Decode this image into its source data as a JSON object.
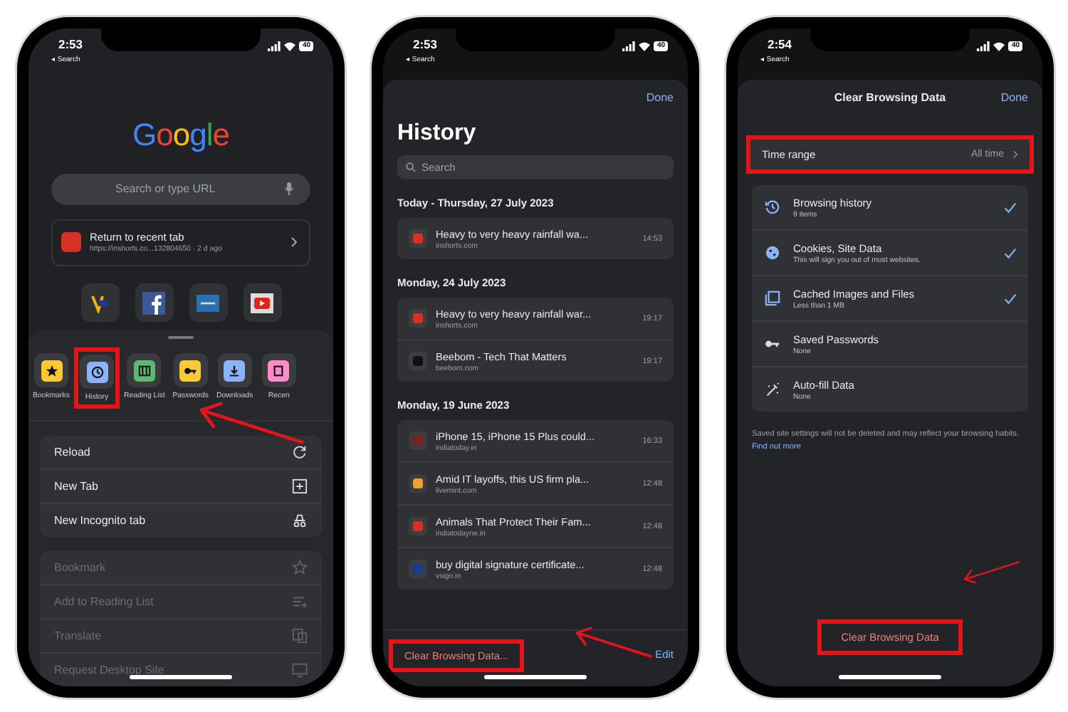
{
  "new_tab_screen": {
    "status_bar": {
      "time": "2:53",
      "back": "◂ Search",
      "battery": "40"
    },
    "logo": "Google",
    "search": {
      "placeholder": "Search or type URL"
    },
    "recent_tab": {
      "title": "Return to recent tab",
      "subtitle": "https://inshorts.co...132804650 · 2 d ago"
    },
    "quick_actions": [
      {
        "kind": "bookmarks",
        "label": "Bookmarks",
        "color": "#fcc934",
        "highlighted": false
      },
      {
        "kind": "history",
        "label": "History",
        "color": "#8ab4f8",
        "highlighted": true
      },
      {
        "kind": "reading_list",
        "label": "Reading List",
        "color": "#5bb974",
        "highlighted": false
      },
      {
        "kind": "passwords",
        "label": "Passwords",
        "color": "#fcc934",
        "highlighted": false
      },
      {
        "kind": "downloads",
        "label": "Downloads",
        "color": "#8ab4f8",
        "highlighted": false
      },
      {
        "kind": "recent",
        "label": "Recen",
        "color": "#ff8bcb",
        "highlighted": false
      }
    ],
    "menu": [
      {
        "kind": "reload",
        "label": "Reload",
        "disabled": false
      },
      {
        "kind": "new_tab",
        "label": "New Tab",
        "disabled": false
      },
      {
        "kind": "incognito",
        "label": "New Incognito tab",
        "disabled": false
      }
    ],
    "menu_2": [
      {
        "kind": "bookmark",
        "label": "Bookmark",
        "disabled": true
      },
      {
        "kind": "reading_list_add",
        "label": "Add to Reading List",
        "disabled": true
      },
      {
        "kind": "translate",
        "label": "Translate",
        "disabled": true
      },
      {
        "kind": "desktop",
        "label": "Request Desktop Site",
        "disabled": true
      }
    ]
  },
  "history_screen": {
    "status_bar": {
      "time": "2:53",
      "back": "◂ Search",
      "battery": "40"
    },
    "done": "Done",
    "title": "History",
    "search": {
      "placeholder": "Search"
    },
    "groups": [
      {
        "heading": "Today - Thursday, 27 July 2023",
        "items": [
          {
            "title": "Heavy to very heavy rainfall wa...",
            "domain": "inshorts.com",
            "time": "14:53",
            "color": "#d93025"
          }
        ]
      },
      {
        "heading": "Monday, 24 July 2023",
        "items": [
          {
            "title": "Heavy to very heavy rainfall war...",
            "domain": "inshorts.com",
            "time": "19:17",
            "color": "#d93025"
          },
          {
            "title": "Beebom - Tech That Matters",
            "domain": "beebom.com",
            "time": "19:17",
            "color": "#111111"
          }
        ]
      },
      {
        "heading": "Monday, 19 June 2023",
        "items": [
          {
            "title": "iPhone 15, iPhone 15 Plus could...",
            "domain": "indiatoday.in",
            "time": "16:33",
            "color": "#7a2020"
          },
          {
            "title": "Amid IT layoffs, this US firm pla...",
            "domain": "livemint.com",
            "time": "12:48",
            "color": "#f0a030"
          },
          {
            "title": "Animals That Protect Their Fam...",
            "domain": "indiatodayne.in",
            "time": "12:48",
            "color": "#d93025"
          },
          {
            "title": "buy digital signature certificate...",
            "domain": "vsign.in",
            "time": "12:48",
            "color": "#1a3a8a"
          }
        ]
      }
    ],
    "clear_button": {
      "label": "Clear Browsing Data...",
      "highlighted": true
    },
    "edit": "Edit"
  },
  "clear_data_screen": {
    "status_bar": {
      "time": "2:54",
      "back": "◂ Search",
      "battery": "40"
    },
    "title": "Clear Browsing Data",
    "done": "Done",
    "time_range": {
      "label": "Time range",
      "value": "All time",
      "highlighted": true
    },
    "options": [
      {
        "kind": "history",
        "label": "Browsing history",
        "detail": "9 items",
        "checked": true
      },
      {
        "kind": "cookies",
        "label": "Cookies, Site Data",
        "detail": "This will sign you out of most websites.",
        "checked": true
      },
      {
        "kind": "cache",
        "label": "Cached Images and Files",
        "detail": "Less than 1 MB",
        "checked": true
      },
      {
        "kind": "passwords",
        "label": "Saved Passwords",
        "detail": "None",
        "checked": false
      },
      {
        "kind": "autofill",
        "label": "Auto-fill Data",
        "detail": "None",
        "checked": false
      }
    ],
    "note": "Saved site settings will not be deleted and may reflect your browsing habits.",
    "note_link": "Find out more",
    "clear_button": {
      "label": "Clear Browsing Data",
      "highlighted": true
    }
  }
}
